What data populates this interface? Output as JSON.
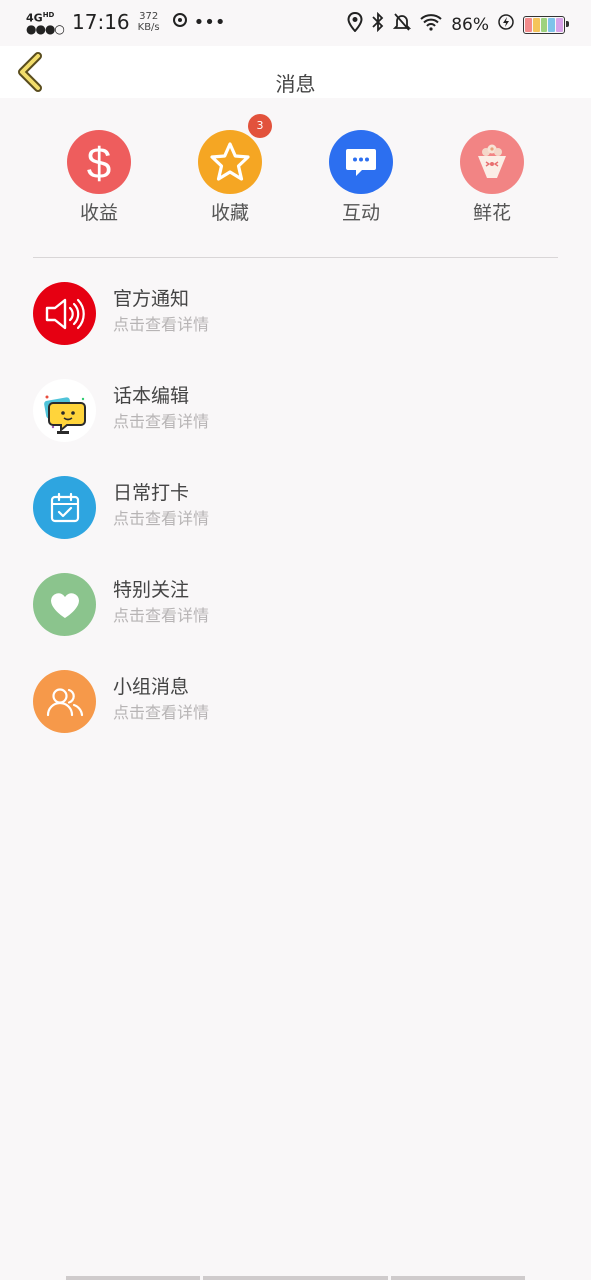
{
  "status_bar": {
    "network": "4G",
    "network_sub": "HD",
    "time": "17:16",
    "speed_value": "372",
    "speed_unit": "KB/s",
    "battery": "86%"
  },
  "header": {
    "title": "消息"
  },
  "quick_actions": [
    {
      "label": "收益",
      "icon": "dollar-icon",
      "color": "#ee5d5d"
    },
    {
      "label": "收藏",
      "icon": "star-icon",
      "color": "#f5a623",
      "badge": "3"
    },
    {
      "label": "互动",
      "icon": "chat-bubble-icon",
      "color": "#2c6ff0"
    },
    {
      "label": "鲜花",
      "icon": "bouquet-icon",
      "color": "#f28484"
    }
  ],
  "list": [
    {
      "title": "官方通知",
      "subtitle": "点击查看详情",
      "icon": "speaker-icon",
      "color": "#e60012"
    },
    {
      "title": "话本编辑",
      "subtitle": "点击查看详情",
      "icon": "chat-character-icon",
      "color": "#ffffff"
    },
    {
      "title": "日常打卡",
      "subtitle": "点击查看详情",
      "icon": "calendar-check-icon",
      "color": "#2ea5e0"
    },
    {
      "title": "特别关注",
      "subtitle": "点击查看详情",
      "icon": "heart-icon",
      "color": "#8bc48d"
    },
    {
      "title": "小组消息",
      "subtitle": "点击查看详情",
      "icon": "group-icon",
      "color": "#f6994a"
    }
  ]
}
